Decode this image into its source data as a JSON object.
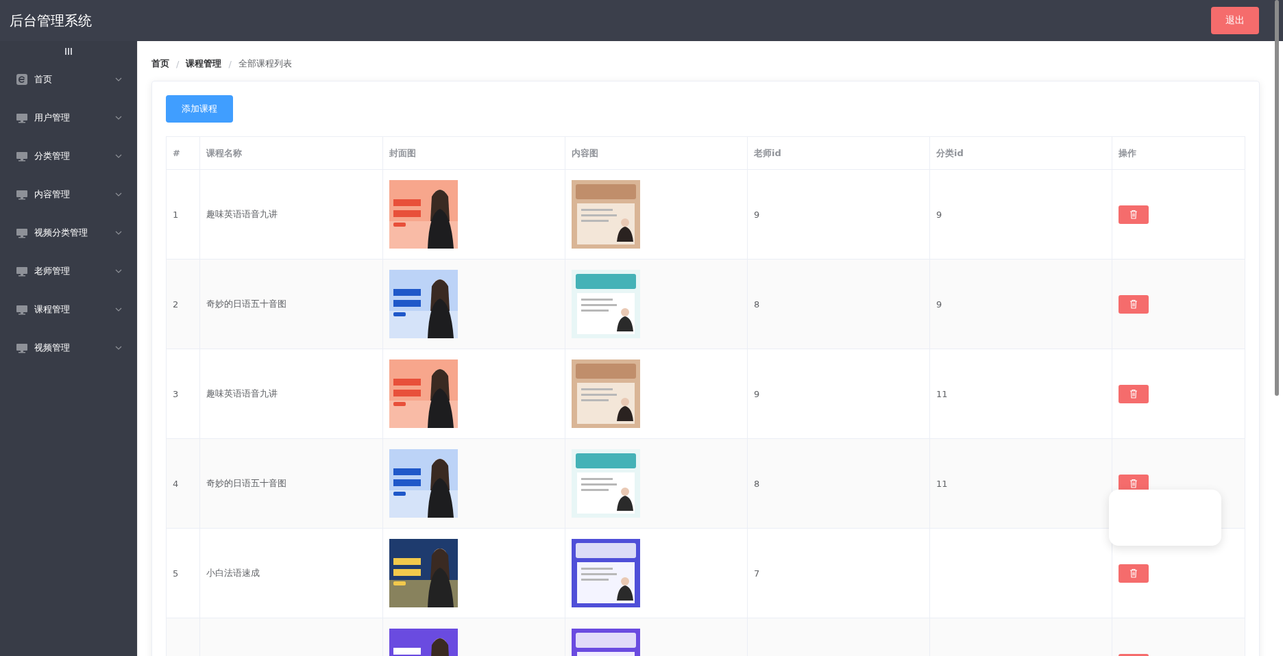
{
  "header": {
    "title": "后台管理系统",
    "logout_button": "退出"
  },
  "sidebar": {
    "items": [
      {
        "label": "首页",
        "kind": "home",
        "expanded": false
      },
      {
        "label": "用户管理",
        "kind": "group",
        "expanded": false
      },
      {
        "label": "分类管理",
        "kind": "group",
        "expanded": false
      },
      {
        "label": "内容管理",
        "kind": "group",
        "expanded": false
      },
      {
        "label": "视频分类管理",
        "kind": "group",
        "expanded": false
      },
      {
        "label": "老师管理",
        "kind": "group",
        "expanded": false
      },
      {
        "label": "课程管理",
        "kind": "group",
        "expanded": false
      },
      {
        "label": "视频管理",
        "kind": "group",
        "expanded": false
      }
    ]
  },
  "breadcrumb": [
    "首页",
    "课程管理",
    "全部课程列表"
  ],
  "breadcrumb_separator": "/",
  "add_button": "添加课程",
  "table": {
    "columns": [
      "#",
      "课程名称",
      "封面图",
      "内容图",
      "老师id",
      "分类id",
      "操作"
    ],
    "rows": [
      {
        "index": "1",
        "name": "趣味英语语音九讲",
        "cover": {
          "kind": "picture"
        },
        "content": {
          "kind": "picture"
        },
        "teacher_id": "9",
        "category_id": "9"
      },
      {
        "index": "2",
        "name": "奇妙的日语五十音图",
        "cover": {
          "kind": "picture"
        },
        "content": {
          "kind": "picture"
        },
        "teacher_id": "8",
        "category_id": "9"
      },
      {
        "index": "3",
        "name": "趣味英语语音九讲",
        "cover": {
          "kind": "picture"
        },
        "content": {
          "kind": "picture"
        },
        "teacher_id": "9",
        "category_id": "11"
      },
      {
        "index": "4",
        "name": "奇妙的日语五十音图",
        "cover": {
          "kind": "picture"
        },
        "content": {
          "kind": "picture"
        },
        "teacher_id": "8",
        "category_id": "11"
      },
      {
        "index": "5",
        "name": "小白法语速成",
        "cover": {
          "kind": "picture"
        },
        "content": {
          "kind": "picture"
        },
        "teacher_id": "7"
      },
      {
        "cover": {
          "kind": "picture"
        },
        "content": {
          "kind": "picture"
        }
      }
    ]
  },
  "overlay_card": {
    "kind": "blank"
  }
}
